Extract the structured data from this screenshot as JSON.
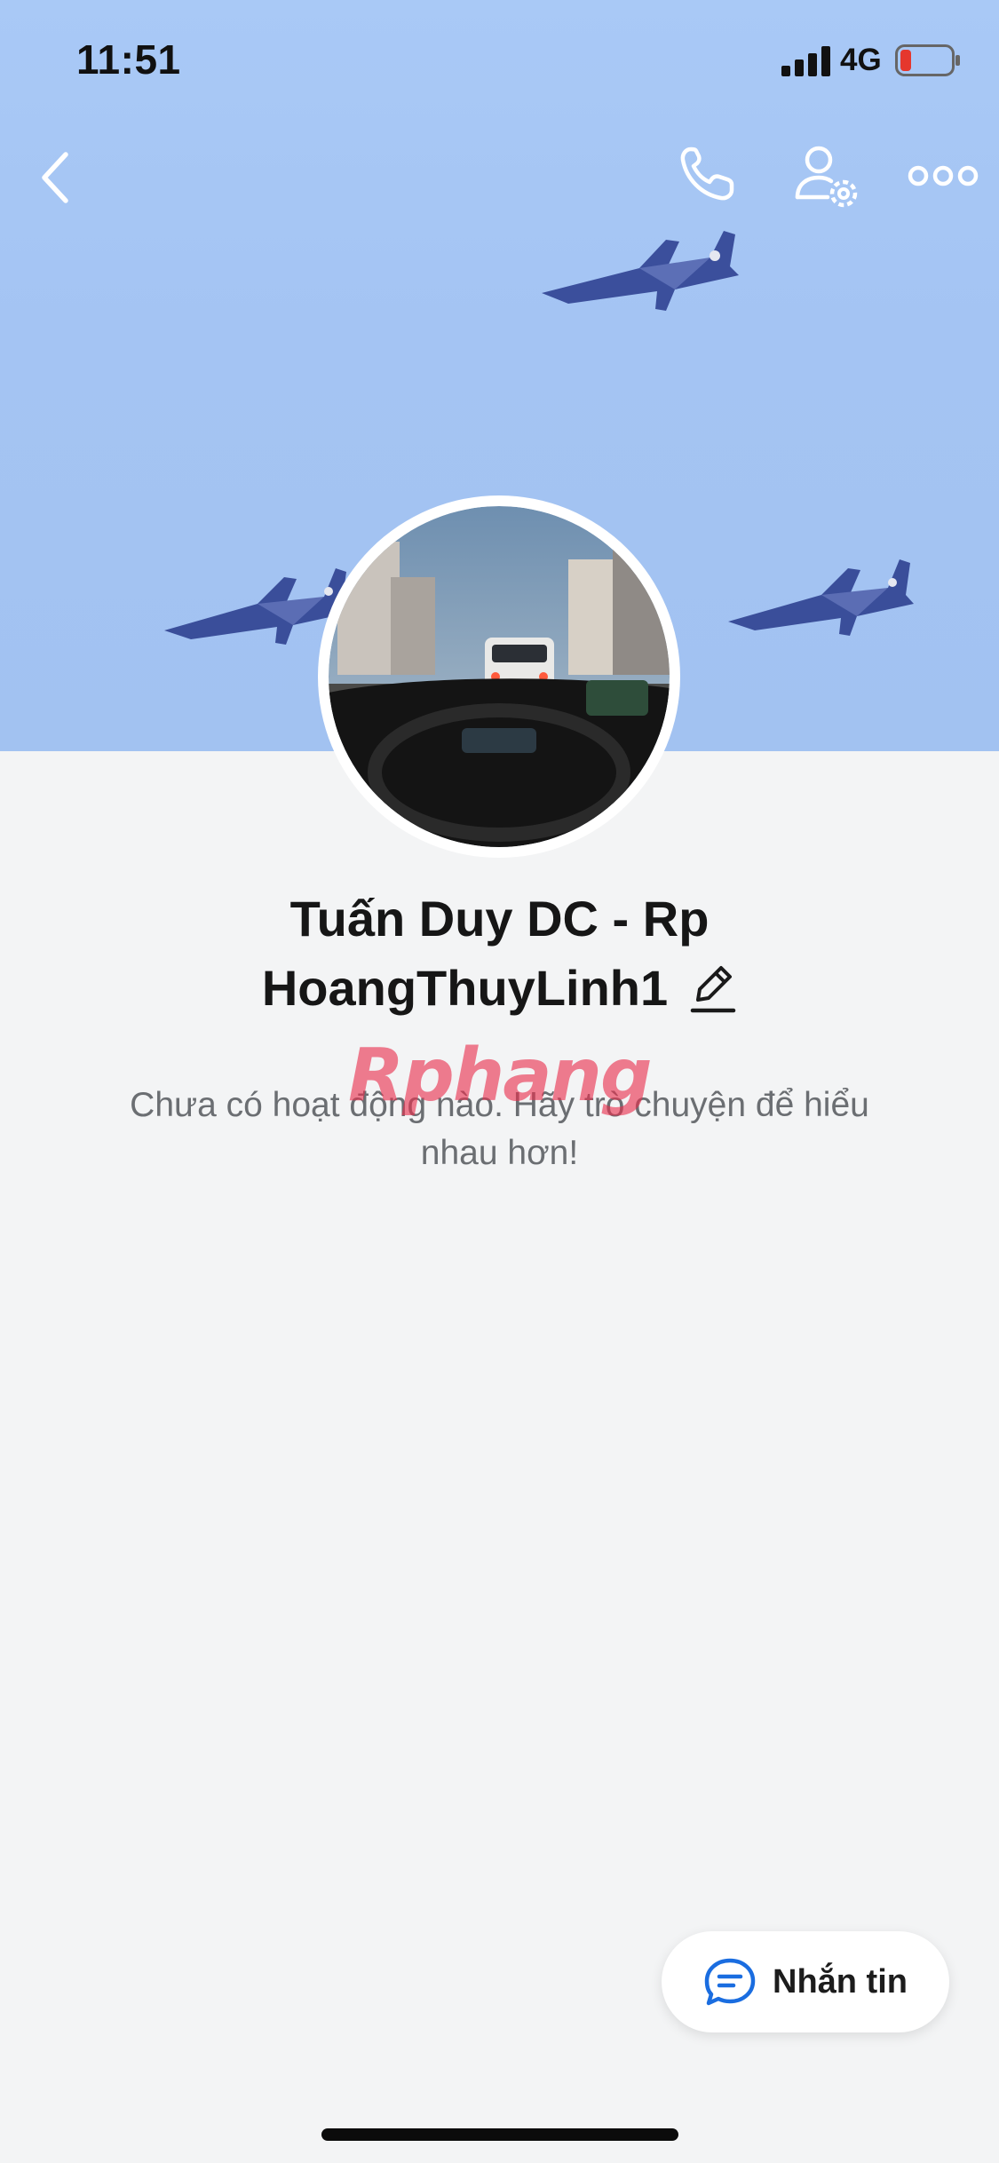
{
  "status_bar": {
    "time": "11:51",
    "network": "4G",
    "battery_icon": "battery-low-icon",
    "signal_icon": "cellular-signal-icon"
  },
  "nav": {
    "back_icon": "chevron-left-icon",
    "call_icon": "phone-icon",
    "profile_settings_icon": "user-gear-icon",
    "more_icon": "ellipsis-icon"
  },
  "profile": {
    "name_line1": "Tuấn Duy DC - Rp",
    "name_line2": "HoangThuyLinh1",
    "edit_icon": "pencil-icon"
  },
  "watermark": {
    "text": "Rphang"
  },
  "feed": {
    "empty_message": "Chưa có hoạt động nào. Hãy trò chuyện để hiểu nhau hơn!"
  },
  "actions": {
    "message_label": "Nhắn tin",
    "message_icon": "chat-bubble-icon"
  },
  "colors": {
    "cover_sky": "#a6c6f4",
    "page_background": "#f3f4f5",
    "accent_blue": "#1a6de0",
    "battery_low": "#e5372d",
    "watermark_red": "#e92f4e",
    "watermark_blue": "#2aa8e8"
  }
}
